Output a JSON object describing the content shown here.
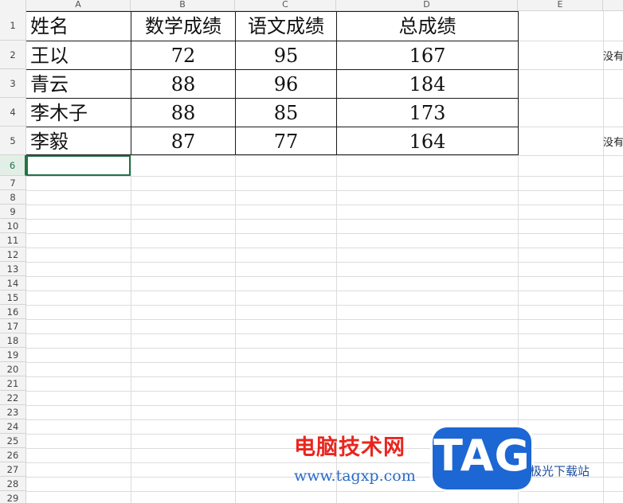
{
  "columns": [
    "A",
    "B",
    "C",
    "D",
    "E"
  ],
  "rows": [
    "1",
    "2",
    "3",
    "4",
    "5",
    "6",
    "7",
    "8",
    "9",
    "10",
    "11",
    "12",
    "13",
    "14",
    "15",
    "16",
    "17",
    "18",
    "19",
    "20",
    "21",
    "22",
    "23",
    "24",
    "25",
    "26",
    "27",
    "28",
    "29"
  ],
  "active_row": "6",
  "table": {
    "header": [
      "姓名",
      "数学成绩",
      "语文成绩",
      "总成绩"
    ],
    "records": [
      [
        "王以",
        "72",
        "95",
        "167"
      ],
      [
        "青云",
        "88",
        "96",
        "184"
      ],
      [
        "李木子",
        "88",
        "85",
        "173"
      ],
      [
        "李毅",
        "87",
        "77",
        "164"
      ]
    ]
  },
  "side_notes": [
    "没有",
    "没有"
  ],
  "watermark": {
    "title": "电脑技术网",
    "url": "www.tagxp.com",
    "badge": "TAG",
    "sub": "极光下载站"
  },
  "colors": {
    "accent": "#217346",
    "grid": "#dcdcdc",
    "border": "#1a1a1a",
    "watermark_red": "#e8261f",
    "watermark_blue": "#1c67d4"
  }
}
